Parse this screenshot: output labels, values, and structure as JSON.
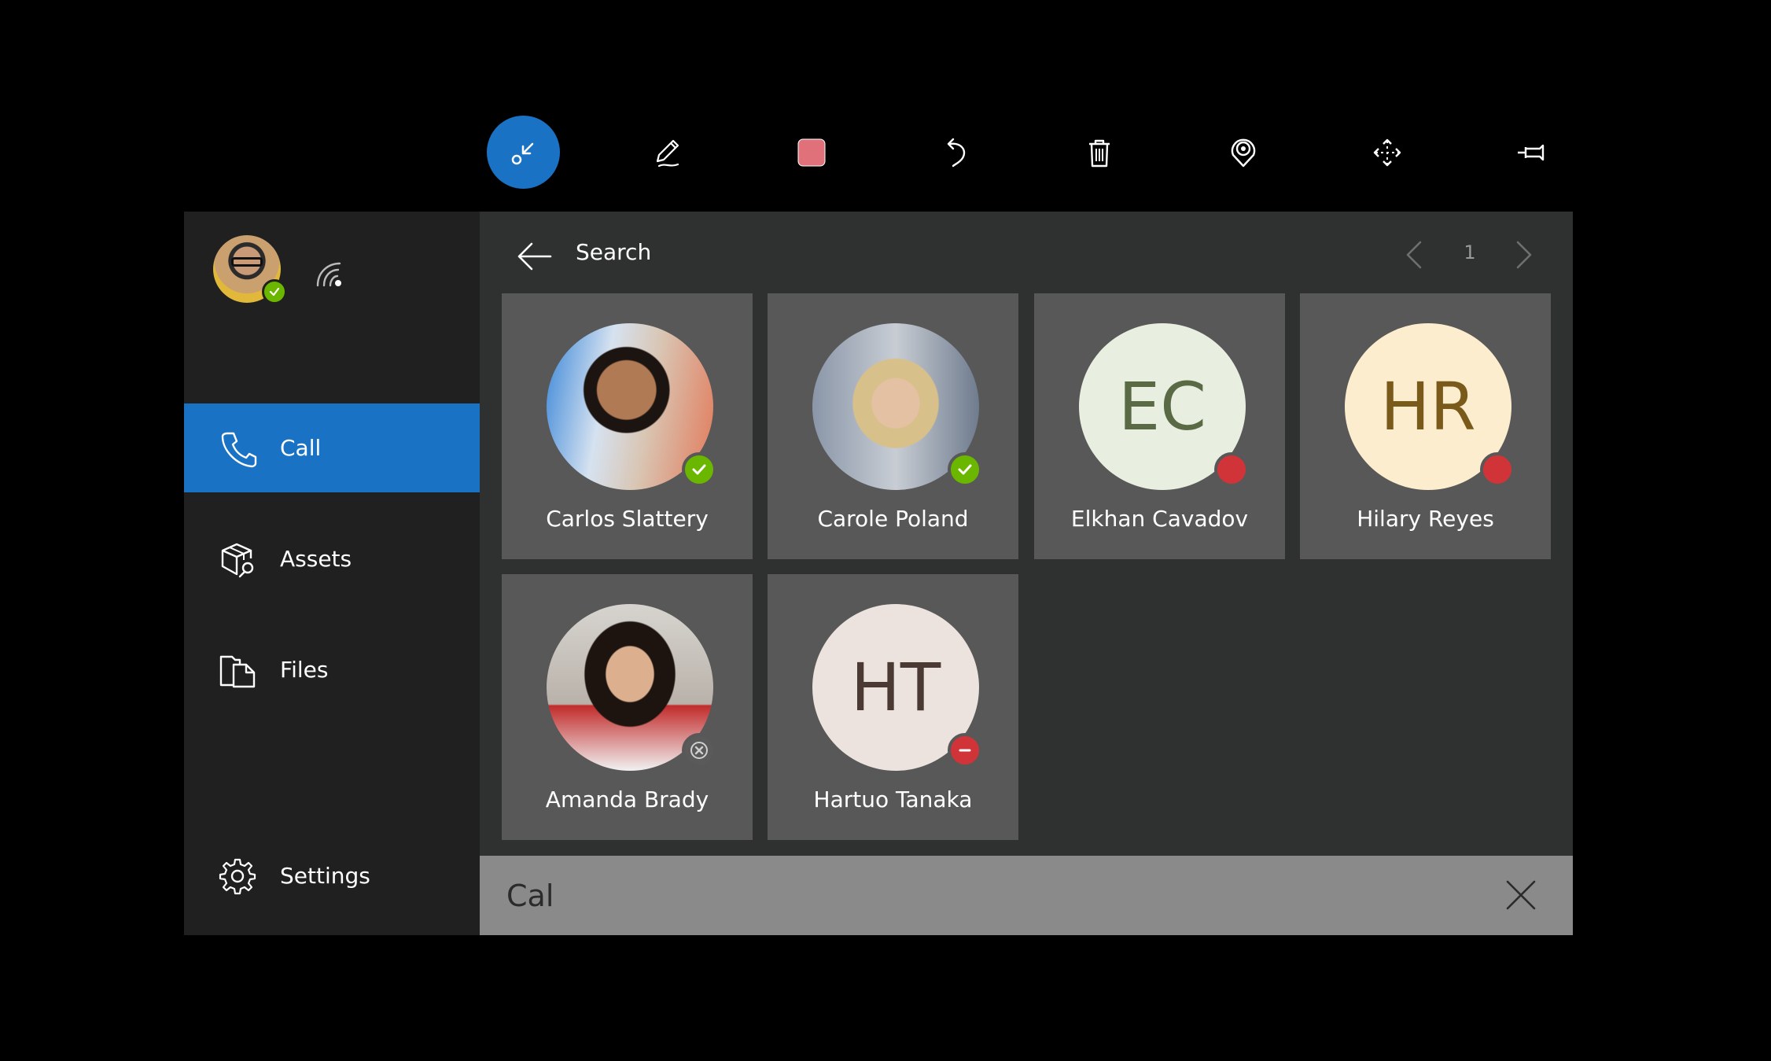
{
  "toolbar": {
    "items": [
      {
        "icon": "minimize-arrows-icon",
        "active": true
      },
      {
        "icon": "pen-icon"
      },
      {
        "icon": "color-swatch-icon",
        "swatch_color": "#e0707a"
      },
      {
        "icon": "undo-icon"
      },
      {
        "icon": "trash-icon"
      },
      {
        "icon": "location-pin-icon"
      },
      {
        "icon": "move-arrows-icon"
      },
      {
        "icon": "pin-icon"
      }
    ]
  },
  "sidebar": {
    "user": {
      "presence": "available",
      "signal_icon": "signal-icon"
    },
    "items": [
      {
        "label": "Call",
        "icon": "phone-icon",
        "active": true
      },
      {
        "label": "Assets",
        "icon": "assets-icon"
      },
      {
        "label": "Files",
        "icon": "files-icon"
      }
    ],
    "settings": {
      "label": "Settings",
      "icon": "gear-icon"
    }
  },
  "main": {
    "header": {
      "title": "Search",
      "page": "1"
    },
    "contacts": [
      {
        "name": "Carlos Slattery",
        "initials": "",
        "presence": "available"
      },
      {
        "name": "Carole Poland",
        "initials": "",
        "presence": "available"
      },
      {
        "name": "Elkhan Cavadov",
        "initials": "EC",
        "presence": "busy",
        "avatar_bg": "#e8eee0",
        "initials_color": "#5a6a45"
      },
      {
        "name": "Hilary Reyes",
        "initials": "HR",
        "presence": "busy",
        "avatar_bg": "#fcedcf",
        "initials_color": "#7a5a1a"
      },
      {
        "name": "Amanda Brady",
        "initials": "",
        "presence": "offline"
      },
      {
        "name": "Hartuo Tanaka",
        "initials": "HT",
        "presence": "do-not-disturb",
        "avatar_bg": "#ece3df",
        "initials_color": "#4a3a33"
      }
    ]
  },
  "search": {
    "value": "Cal",
    "placeholder": ""
  },
  "colors": {
    "accent": "#1a72c4",
    "available": "#6bb700",
    "busy": "#d13438"
  }
}
